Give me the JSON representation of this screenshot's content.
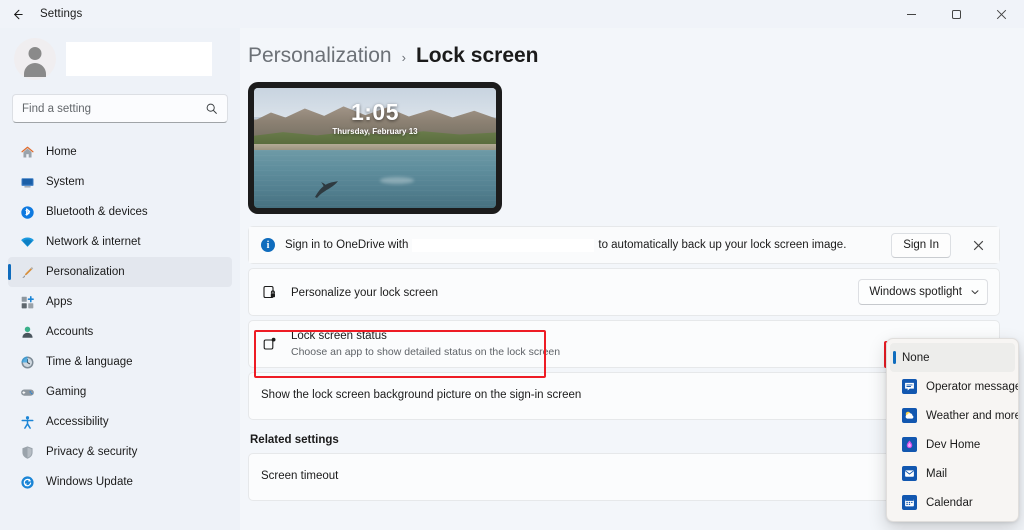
{
  "window": {
    "title": "Settings",
    "back_icon": "back-arrow-icon",
    "minimize_label": "Minimize",
    "maximize_label": "Maximize",
    "close_label": "Close"
  },
  "sidebar": {
    "account": {
      "avatar_icon": "user-avatar-icon",
      "name": ""
    },
    "search": {
      "placeholder": "Find a setting",
      "value": "",
      "icon": "search-icon"
    },
    "items": [
      {
        "label": "Home",
        "icon": "home-icon",
        "active": false
      },
      {
        "label": "System",
        "icon": "system-icon",
        "active": false
      },
      {
        "label": "Bluetooth & devices",
        "icon": "bluetooth-icon",
        "active": false
      },
      {
        "label": "Network & internet",
        "icon": "network-icon",
        "active": false
      },
      {
        "label": "Personalization",
        "icon": "brush-icon",
        "active": true
      },
      {
        "label": "Apps",
        "icon": "apps-icon",
        "active": false
      },
      {
        "label": "Accounts",
        "icon": "accounts-icon",
        "active": false
      },
      {
        "label": "Time & language",
        "icon": "clock-icon",
        "active": false
      },
      {
        "label": "Gaming",
        "icon": "gamepad-icon",
        "active": false
      },
      {
        "label": "Accessibility",
        "icon": "accessibility-icon",
        "active": false
      },
      {
        "label": "Privacy & security",
        "icon": "shield-icon",
        "active": false
      },
      {
        "label": "Windows Update",
        "icon": "update-icon",
        "active": false
      }
    ]
  },
  "main": {
    "breadcrumb": {
      "parent": "Personalization",
      "separator": "›",
      "current": "Lock screen"
    },
    "preview": {
      "time": "1:05",
      "date": "Thursday, February 13",
      "alt": "lock-screen-preview"
    },
    "banner": {
      "icon": "info-icon",
      "text_before": "Sign in to OneDrive with",
      "redacted": "",
      "text_after": "to automatically back up your lock screen image.",
      "sign_in_label": "Sign In",
      "close_icon": "close-icon"
    },
    "rows": [
      {
        "icon": "personalize-lock-icon",
        "title": "Personalize your lock screen",
        "sub": "",
        "control": "combo",
        "value": "Windows spotlight",
        "chevron": "chevron-down-icon"
      },
      {
        "icon": "lock-status-icon",
        "title": "Lock screen status",
        "sub": "Choose an app to show detailed status on the lock screen",
        "control": "none",
        "value": "",
        "chevron": ""
      },
      {
        "icon": "",
        "title": "Show the lock screen background picture on the sign-in screen",
        "sub": "",
        "control": "none",
        "value": "",
        "chevron": ""
      }
    ],
    "related": {
      "title": "Related settings",
      "items": [
        {
          "title": "Screen timeout"
        }
      ]
    }
  },
  "dropdown": {
    "open": true,
    "selected": "None",
    "options": [
      {
        "label": "None",
        "icon": "none-icon",
        "selected": true
      },
      {
        "label": "Operator messages",
        "icon": "operator-messages-icon",
        "selected": false
      },
      {
        "label": "Weather and more",
        "icon": "weather-icon",
        "selected": false
      },
      {
        "label": "Dev Home",
        "icon": "dev-home-icon",
        "selected": false
      },
      {
        "label": "Mail",
        "icon": "mail-icon",
        "selected": false
      },
      {
        "label": "Calendar",
        "icon": "calendar-icon",
        "selected": false
      }
    ]
  },
  "highlights": [
    {
      "name": "lock-screen-status-highlight",
      "color": "#ee1c25"
    },
    {
      "name": "none-option-highlight",
      "color": "#ee1c25"
    }
  ],
  "colors": {
    "accent": "#0f6cbd",
    "highlight": "#ee1c25",
    "sidebar_bg": "#eef2f8",
    "page_bg": "#f3f6fa",
    "card_bg": "#fbfcfd"
  }
}
